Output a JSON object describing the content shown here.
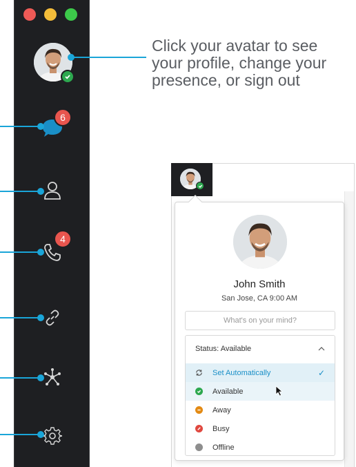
{
  "hint": {
    "text": "Click your avatar to see your profile, change your presence, or sign out"
  },
  "sidebar": {
    "messages_badge": "6",
    "calls_badge": "4"
  },
  "profile": {
    "name": "John Smith",
    "location": "San Jose, CA 9:00 AM",
    "mind_placeholder": "What's on your mind?"
  },
  "status": {
    "header": "Status: Available",
    "items": [
      {
        "label": "Set Automatically",
        "icon": "sync-icon",
        "color": "#1a8fc7"
      },
      {
        "label": "Available",
        "icon": "available-dot",
        "color": "#2da84f"
      },
      {
        "label": "Away",
        "icon": "away-dot",
        "color": "#e38a14"
      },
      {
        "label": "Busy",
        "icon": "busy-dot",
        "color": "#e0483f"
      },
      {
        "label": "Offline",
        "icon": "offline-dot",
        "color": "#8e8e8e"
      }
    ]
  },
  "colors": {
    "sidebar_bg": "#1e1f22",
    "accent": "#1aa5d8",
    "badge": "#e8554e",
    "available": "#2da84f"
  }
}
